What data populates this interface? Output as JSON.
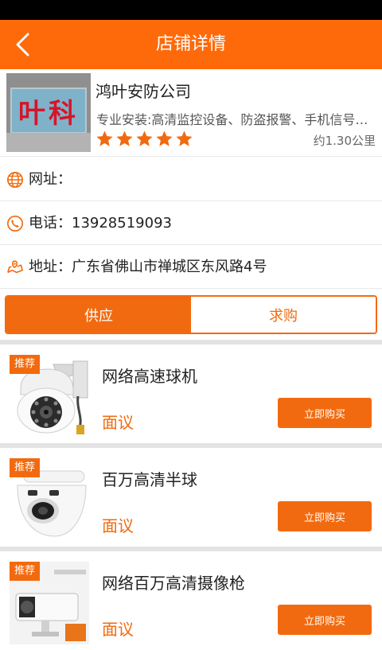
{
  "header": {
    "title": "店铺详情"
  },
  "shop": {
    "logo_text": "叶科",
    "name": "鸿叶安防公司",
    "description": "专业安装:高清监控设备、防盗报警、手机信号放大器",
    "rating_stars": 5,
    "distance": "约1.30公里"
  },
  "info": {
    "website_label": "网址：",
    "phone_label": "电话：13928519093",
    "address_label": "地址：广东省佛山市禅城区东风路4号"
  },
  "tabs": {
    "supply": "供应",
    "purchase": "求购",
    "active": "supply"
  },
  "products": [
    {
      "badge": "推荐",
      "name": "网络高速球机",
      "price": "面议",
      "buy_label": "立即购买",
      "thumb_icon": "ptz-dome-camera-icon"
    },
    {
      "badge": "推荐",
      "name": "百万高清半球",
      "price": "面议",
      "buy_label": "立即购买",
      "thumb_icon": "dome-camera-icon"
    },
    {
      "badge": "推荐",
      "name": "网络百万高清摄像枪",
      "price": "面议",
      "buy_label": "立即购买",
      "thumb_icon": "bullet-camera-icon"
    }
  ],
  "colors": {
    "accent": "#fe6a0a",
    "star": "#f26a0f"
  }
}
